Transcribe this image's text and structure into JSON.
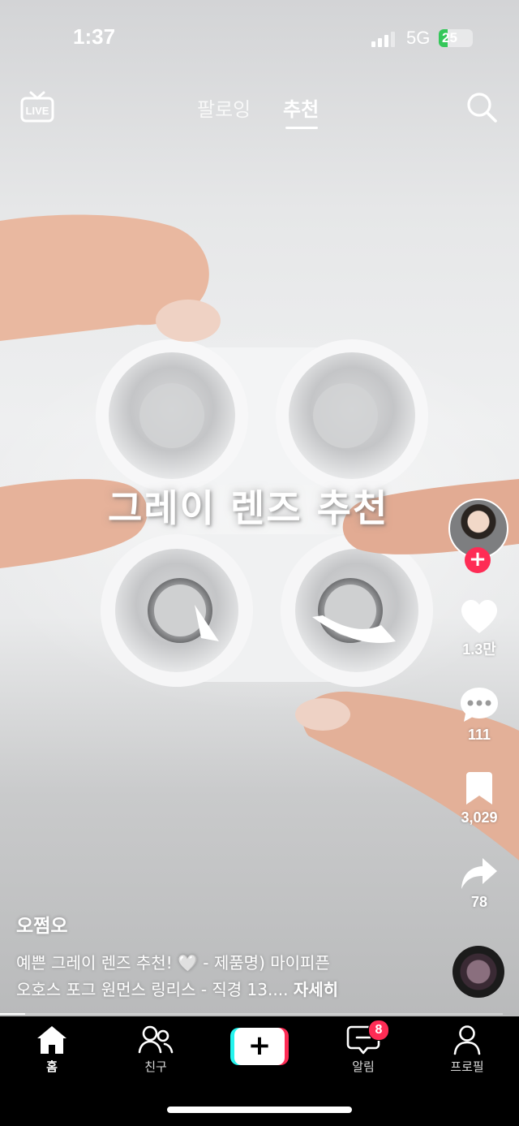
{
  "status_bar": {
    "time": "1:37",
    "network": "5G",
    "battery": "25",
    "battery_level_percent": 25
  },
  "top_nav": {
    "tabs": [
      "팔로잉",
      "추천"
    ],
    "active_tab": "추천"
  },
  "video": {
    "overlay_text": "그레이 렌즈 추천"
  },
  "actions": {
    "likes": "1.3만",
    "comments": "111",
    "bookmarks": "3,029",
    "shares": "78"
  },
  "caption": {
    "username": "오쩜오",
    "line1": "예쁜 그레이 렌즈 추천! 🤍 - 제품명) 마이피픈",
    "line2": "오호스 포그 원먼스 링리스 - 직경 13....",
    "see_more": "자세히"
  },
  "playback_progress_percent": 5,
  "bottom_nav": {
    "home": "홈",
    "friends": "친구",
    "inbox": "알림",
    "inbox_badge": "8",
    "profile": "프로필",
    "create": "+"
  },
  "colors": {
    "accent_red": "#fe2c55",
    "accent_cyan": "#25f4ee",
    "battery_green": "#34c759"
  },
  "icons": [
    "live-icon",
    "search-icon",
    "heart-icon",
    "comment-icon",
    "bookmark-icon",
    "share-icon",
    "home-icon",
    "friends-icon",
    "inbox-icon",
    "profile-icon",
    "signal-icon"
  ]
}
